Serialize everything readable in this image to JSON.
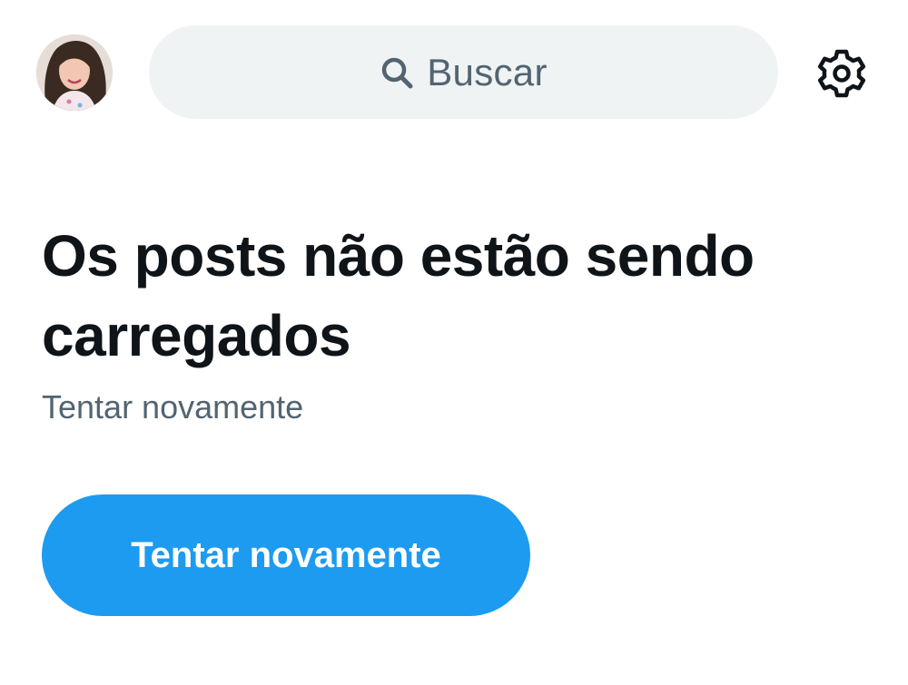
{
  "header": {
    "avatar": {
      "icon": "user-avatar-photo"
    },
    "search": {
      "placeholder": "Buscar",
      "icon": "search-icon"
    },
    "settings": {
      "icon": "gear-icon"
    }
  },
  "error": {
    "title": "Os posts não estão sendo carregados",
    "message": "Tentar novamente",
    "retry_label": "Tentar novamente"
  },
  "colors": {
    "accent": "#1d9bf0",
    "text_primary": "#0f1419",
    "text_secondary": "#536471",
    "search_bg": "#eff3f4"
  }
}
